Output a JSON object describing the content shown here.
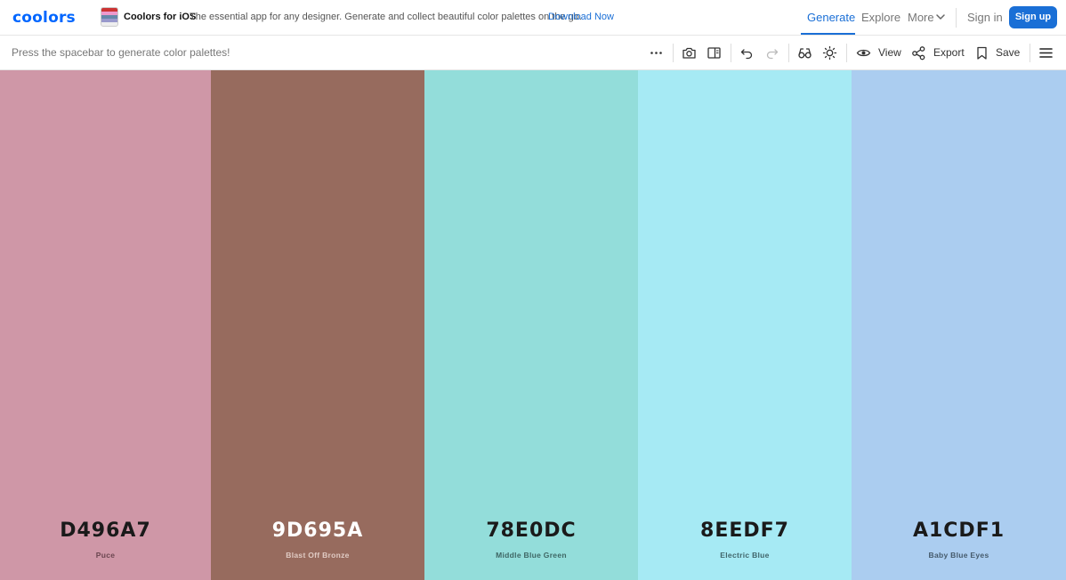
{
  "header": {
    "logo": "coolors",
    "promo": {
      "title": "Coolors for iOS",
      "text": "The essential app for any designer. Generate and collect beautiful color palettes on the go.",
      "link": "Download Now"
    },
    "nav": {
      "generate": "Generate",
      "explore": "Explore",
      "more": "More",
      "sign_in": "Sign in",
      "sign_up": "Sign up"
    },
    "accent": "#1a6fd6"
  },
  "toolbar": {
    "hint": "Press the spacebar to generate color palettes!",
    "icons": [
      "more-dots-icon",
      "camera-icon",
      "sidebar-panel-icon",
      "undo-icon",
      "redo-icon",
      "glasses-icon",
      "sun-icon",
      "eye-icon",
      "share-icon",
      "bookmark-icon",
      "hamburger-menu-icon"
    ],
    "view_label": "View",
    "export_label": "Export",
    "save_label": "Save"
  },
  "palette": [
    {
      "hex": "D496A7",
      "name": "Puce",
      "color": "#cf97a7",
      "text_color": "#1a1a1a",
      "name_color": "#6b4650"
    },
    {
      "hex": "9D695A",
      "name": "Blast Off Bronze",
      "color": "#976b5e",
      "text_color": "#ffffff",
      "name_color": "#e0cbc4"
    },
    {
      "hex": "78E0DC",
      "name": "Middle Blue Green",
      "color": "#93ddda",
      "text_color": "#1a1a1a",
      "name_color": "#3e6664"
    },
    {
      "hex": "8EEDF7",
      "name": "Electric Blue",
      "color": "#a6eaf4",
      "text_color": "#1a1a1a",
      "name_color": "#41666b"
    },
    {
      "hex": "A1CDF1",
      "name": "Baby Blue Eyes",
      "color": "#abcdf0",
      "text_color": "#1a1a1a",
      "name_color": "#455a6b"
    }
  ]
}
